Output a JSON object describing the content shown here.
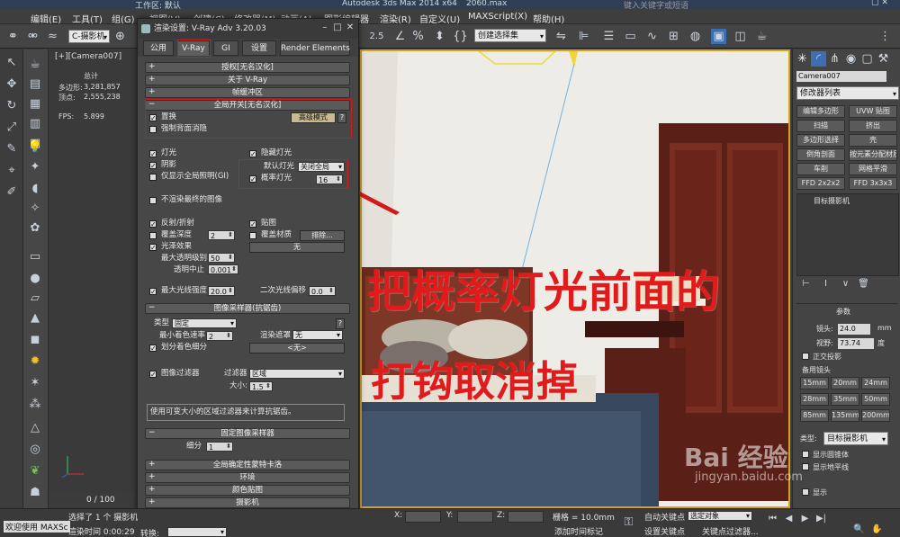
{
  "window": {
    "workspace_label": "工作区: 默认",
    "app_title": "Autodesk 3ds Max  2014 x64",
    "file_name": "2060.max",
    "search_placeholder": "键入关键字或短语"
  },
  "menu": [
    "编辑(E)",
    "工具(T)",
    "组(G)",
    "视图(V)",
    "创建(C)",
    "修改器(M)",
    "动画(A)",
    "图形编辑器",
    "渲染(R)",
    "自定义(U)",
    "MAXScript(X)",
    "帮助(H)"
  ],
  "toolbar": {
    "view_combo": "C-摄影机",
    "selection_set_combo": "创建选择集",
    "snap_value": "2.5",
    "percent_label": "%"
  },
  "left_viewport": {
    "label": "[+][Camera007]",
    "stats_title": "总计",
    "polys_label": "多边形:",
    "polys_value": "3,281,857",
    "verts_label": "顶点:",
    "verts_value": "2,555,238",
    "fps_label": "FPS:",
    "fps_value": "5.899"
  },
  "dialog": {
    "title": "渲染设置: V-Ray Adv 3.20.03",
    "tabs": [
      "公用",
      "V-Ray",
      "GI",
      "设置",
      "Render Elements"
    ],
    "active_tab": "V-Ray",
    "rollouts_top": [
      "授权[无名汉化]",
      "关于 V-Ray",
      "帧缓冲区"
    ],
    "global_switches": {
      "header": "全局开关[无名汉化]",
      "displacement": "置换",
      "advanced_mode": "高级模式",
      "force_backface": "强制背面消隐",
      "lights": "灯光",
      "shadows": "阴影",
      "show_gi_only": "仅显示全局照明(GI)",
      "hidden_lights": "隐藏灯光",
      "default_lights_label": "默认灯光",
      "default_lights_value": "关闭全局",
      "prob_lights": "概率灯光",
      "prob_lights_value": "16",
      "dont_render_final": "不渲染最终的图像",
      "reflection_refraction": "反射/折射",
      "override_depth": "覆盖深度",
      "override_depth_value": "2",
      "glossy_effects": "光泽效果",
      "max_transp_levels": "最大透明级别",
      "max_transp_value": "50",
      "transp_cutoff": "透明中止",
      "transp_cutoff_value": "0.001",
      "maps": "贴图",
      "override_mtl": "覆盖材质",
      "exclude_btn": "排除...",
      "none_btn": "无",
      "max_ray_intensity": "最大光线强度",
      "max_ray_value": "20.0",
      "secondary_bias": "二次光线偏移",
      "secondary_bias_value": "0.0"
    },
    "image_sampler": {
      "header": "图像采样器(抗锯齿)",
      "type_label": "类型",
      "type_value": "固定",
      "min_shading_rate": "最小着色速率",
      "min_shading_value": "2",
      "render_mask": "渲染遮罩",
      "render_mask_value": "无",
      "divide_shading": "划分着色细分",
      "none_value": "<无>",
      "image_filter": "图像过滤器",
      "filter_label": "过滤器",
      "filter_value": "区域",
      "size_label": "大小:",
      "size_value": "1.5",
      "description": "使用可变大小的区域过滤器来计算抗锯齿。"
    },
    "fixed_sampler": {
      "header": "固定图像采样器",
      "subdivs_label": "细分",
      "subdivs_value": "1"
    },
    "rollouts_bottom": [
      "全局确定性蒙特卡洛",
      "环境",
      "颜色贴图",
      "摄影机"
    ]
  },
  "command_panel": {
    "object_name": "Camera007",
    "modifier_list": "修改器列表",
    "buttons": [
      "编辑多边形",
      "UVW 贴图",
      "扫描",
      "挤出",
      "多边形选择",
      "壳",
      "倒角剖面",
      "按元素分配材质",
      "车削",
      "网格平滑",
      "FFD 2x2x2",
      "FFD 3x3x3"
    ],
    "stack_item": "目标摄影机",
    "params_header": "参数",
    "lens_label": "镜头:",
    "lens_value": "24.0",
    "lens_unit": "mm",
    "fov_label": "视野:",
    "fov_value": "73.74",
    "fov_unit": "度",
    "ortho": "正交投影",
    "stock_lenses": "备用镜头",
    "lenses": [
      "15mm",
      "20mm",
      "24mm",
      "28mm",
      "35mm",
      "50mm",
      "85mm",
      "135mm",
      "200mm"
    ],
    "type_label": "类型:",
    "type_value": "目标摄影机",
    "show_cone": "显示圆锥体",
    "show_horizon": "显示地平线",
    "env_ranges": "显示"
  },
  "bottom": {
    "frame_counter": "0 / 100",
    "welcome": "欢迎使用 MAXSc",
    "selected": "选择了 1 个 摄影机",
    "render_time": "渲染时间 0:00:29",
    "grid": "栅格 = 10.0mm",
    "x_label": "X:",
    "y_label": "Y:",
    "z_label": "Z:",
    "auto_key": "自动关键点",
    "set_key": "设置关键点",
    "selected_obj": "选定对象",
    "key_filters": "关键点过滤器...",
    "add_time_tag": "添加时间标记",
    "transform_label": "转换:"
  },
  "annotation": {
    "line1": "把概率灯光前面的",
    "line2": "打钩取消掉"
  },
  "watermark": {
    "brand": "Bai 经验",
    "url": "jingyan.baidu.com"
  },
  "colors": {
    "annotation_red": "#e11b1b",
    "viewport_border": "#d6a21e",
    "active_button": "#3d6fb0"
  }
}
